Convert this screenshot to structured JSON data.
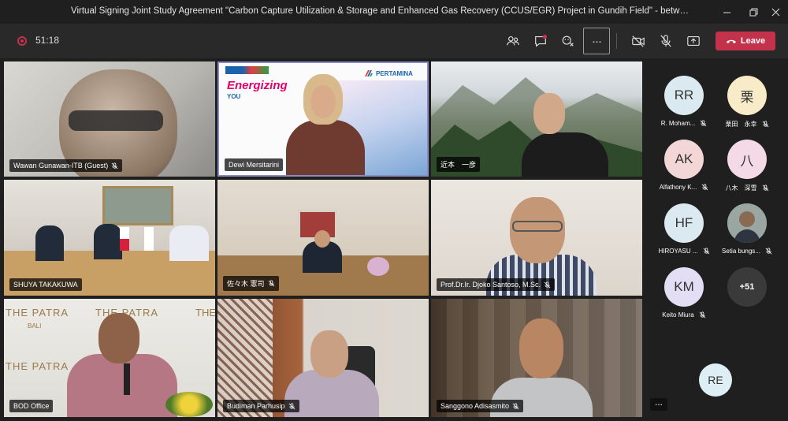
{
  "window": {
    "title": "Virtual Signing Joint Study Agreement \"Carbon Capture Utilization & Storage and Enhanced Gas Recovery (CCUS/EGR) Project in Gundih Field\" - between PT Pertamina (Pers..."
  },
  "toolbar": {
    "timer": "51:18",
    "more_label": "···",
    "leave_label": "Leave"
  },
  "tiles": [
    {
      "name": "Wawan Gunawan-ITB (Guest)"
    },
    {
      "name": "Dewi Mersitarini"
    },
    {
      "name": "近本　一彦"
    },
    {
      "name": "SHUYA TAKAKUWA"
    },
    {
      "name": "佐々木 憲司"
    },
    {
      "name": "Prof.Dr.Ir. Djoko Santoso, M.Sc."
    },
    {
      "name": "BOD Office"
    },
    {
      "name": "Budiman Parhusip"
    },
    {
      "name": "Sanggono Adisasmito"
    }
  ],
  "tile_text": {
    "energizing": "Energizing",
    "you": "YOU",
    "pertamina": "PERTAMINA",
    "patra1": "THE PATRA",
    "bali": "BALI",
    "patra2": "THE PATRA",
    "patra3": "THE PATRA",
    "the": "THE"
  },
  "roster": [
    {
      "initials": "RR",
      "name": "R. Moham...",
      "color": "#dbe9f0"
    },
    {
      "initials": "栗",
      "name": "栗田　永幸",
      "color": "#f7ebc8"
    },
    {
      "initials": "AK",
      "name": "Alfathony K...",
      "color": "#f3d7d7"
    },
    {
      "initials": "八",
      "name": "八木　深雪",
      "color": "#f4d9e6"
    },
    {
      "initials": "HF",
      "name": "HIROYASU ...",
      "color": "#dbe9f0"
    },
    {
      "initials": "",
      "name": "Setia bungs...",
      "color": "#7d8a86"
    },
    {
      "initials": "KM",
      "name": "Keito Miura",
      "color": "#e3def3"
    },
    {
      "initials": "+51",
      "name": "",
      "color": "#3a3a3a"
    }
  ],
  "bottom": {
    "re_initials": "RE",
    "dots": "..."
  }
}
